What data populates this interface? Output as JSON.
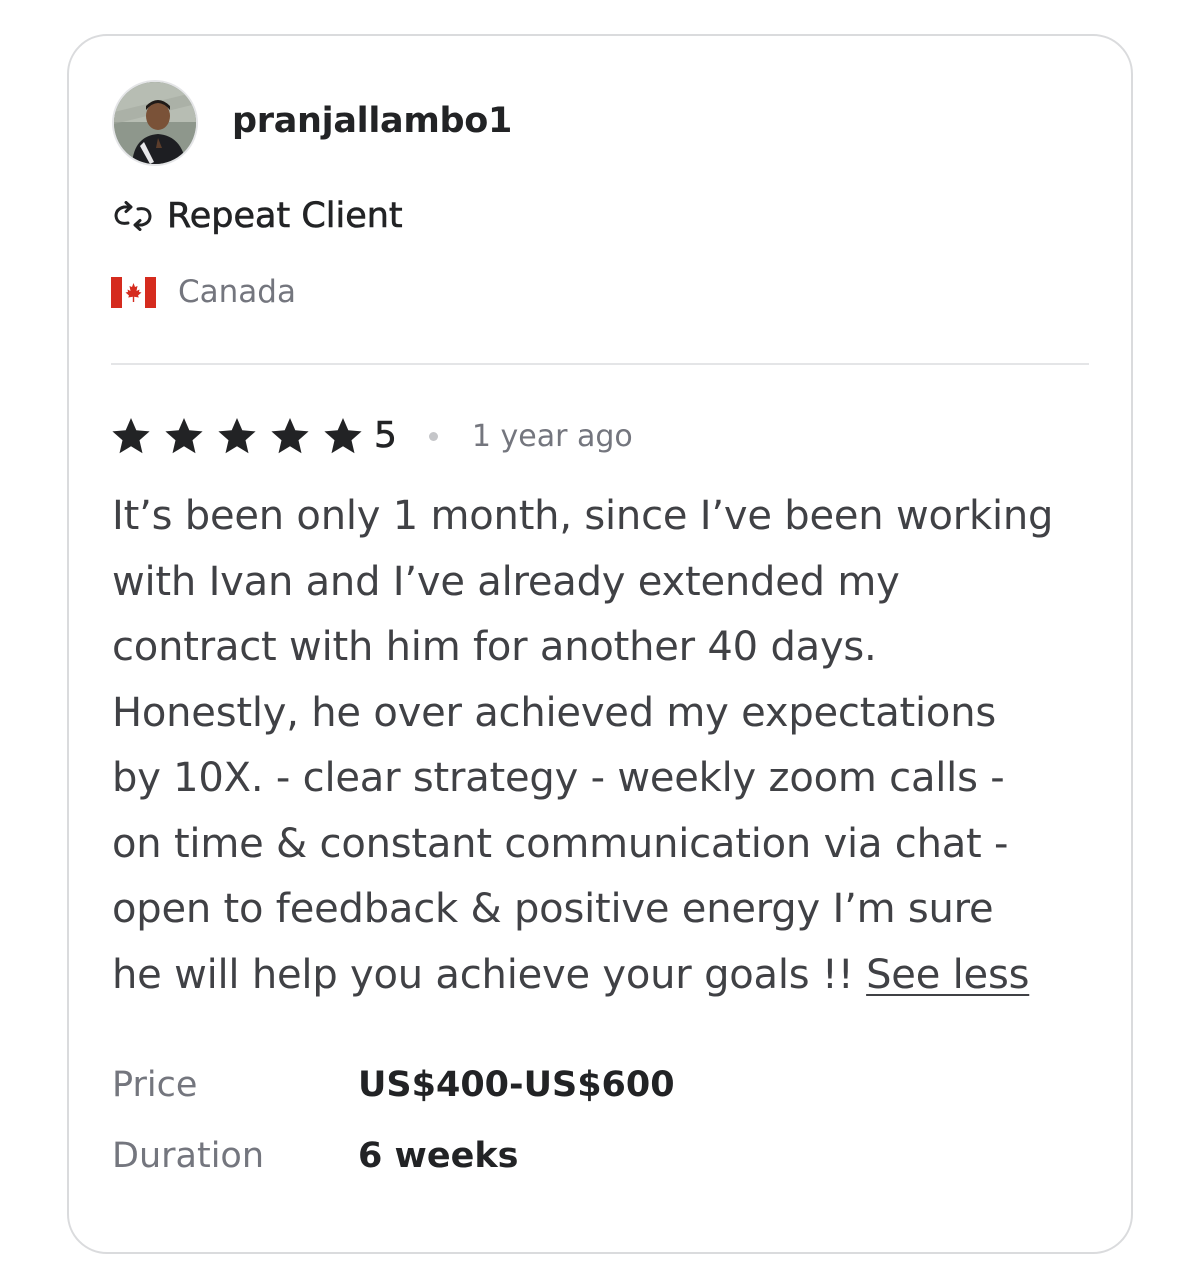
{
  "reviewer": {
    "username": "pranjallambo1",
    "badge": "Repeat Client",
    "country": "Canada",
    "badge_icon": "repeat-icon",
    "country_icon": "canada-flag-icon"
  },
  "rating": {
    "stars": 5,
    "value": "5",
    "time_ago": "1 year ago",
    "star_color": "#222325"
  },
  "review": {
    "lines": [
      "It’s been only 1 month, since I’ve been working",
      "with Ivan and I’ve already extended my",
      "contract with him for another 40 days.",
      "Honestly, he over achieved my expectations",
      "by 10X. - clear strategy - weekly zoom calls -",
      "on time & constant communication via chat -",
      "open to feedback & positive energy I’m sure",
      "he will help you achieve your goals !! "
    ],
    "see_less_label": "See less"
  },
  "details": {
    "price_label": "Price",
    "price_value": "US$400-US$600",
    "duration_label": "Duration",
    "duration_value": "6 weeks"
  },
  "colors": {
    "text_primary": "#222325",
    "text_secondary": "#74767e",
    "body_text": "#404145",
    "border": "#dadbdd",
    "flag_red": "#d52b1e"
  }
}
